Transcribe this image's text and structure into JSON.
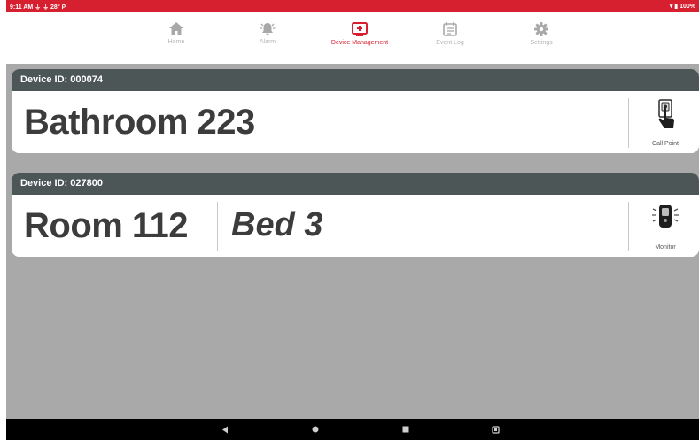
{
  "status_bar": {
    "left_text": "9:11 AM  ⏚ ⏚ 28° ᑭ",
    "right_text": "▾ ▮ 100%"
  },
  "nav": {
    "items": [
      {
        "label": "Home",
        "icon": "home-icon",
        "active": false
      },
      {
        "label": "Alarm",
        "icon": "alarm-bell-icon",
        "active": false
      },
      {
        "label": "Device Management",
        "icon": "device-management-icon",
        "active": true
      },
      {
        "label": "Event Log",
        "icon": "calendar-icon",
        "active": false
      },
      {
        "label": "Settings",
        "icon": "gear-icon",
        "active": false
      }
    ]
  },
  "devices": [
    {
      "header": "Device ID: 000074",
      "location": "Bathroom 223",
      "bed": "",
      "type_label": "Call Point",
      "type_icon": "call-point-icon"
    },
    {
      "header": "Device ID: 027800",
      "location": "Room 112",
      "bed": "Bed 3",
      "type_label": "Monitor",
      "type_icon": "monitor-icon"
    }
  ],
  "system_nav": [
    "back-icon",
    "home-dot-icon",
    "recents-icon",
    "screenshot-icon"
  ],
  "colors": {
    "accent": "#d6202f",
    "card_header": "#4c5656",
    "background": "#a9a9a9",
    "inactive_nav": "#b4b4b4"
  }
}
